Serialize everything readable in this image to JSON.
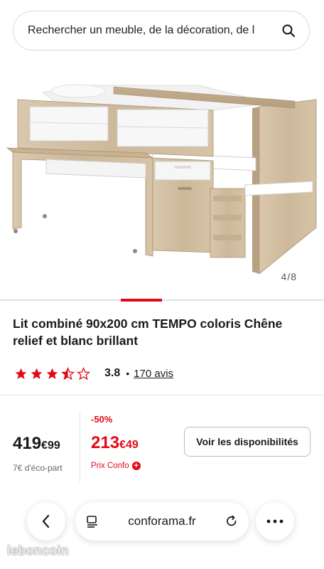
{
  "search": {
    "value": "Rechercher un meuble, de la décoration, de l"
  },
  "gallery": {
    "counter": "4/8",
    "image_icon": "bed-desk-furniture"
  },
  "product": {
    "title": "Lit combiné 90x200 cm TEMPO coloris Chêne relief et blanc brillant",
    "rating": {
      "value": "3.8",
      "stars": 3.5,
      "star_color": "#e20a16",
      "separator": "•",
      "reviews_label": "170 avis"
    }
  },
  "pricing": {
    "old_price_main": "419",
    "old_price_cents": "€99",
    "eco_part": "7€ d'éco-part",
    "discount": "-50%",
    "new_price_main": "213",
    "new_price_cents": "€49",
    "prix_confo_label": "Prix Confo",
    "accent_color": "#e20a16"
  },
  "actions": {
    "availability_label": "Voir les disponibilités"
  },
  "browser": {
    "url": "conforama.fr"
  },
  "watermark": {
    "text": "leboncoin"
  }
}
